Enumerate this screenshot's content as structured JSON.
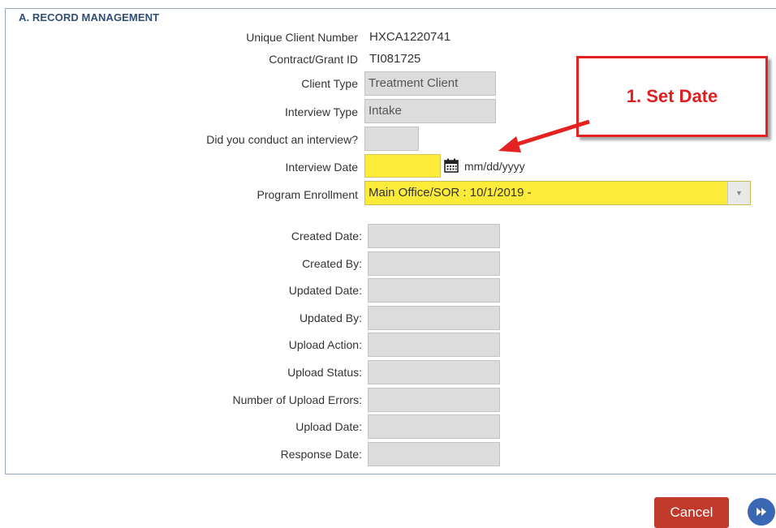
{
  "section": {
    "title": "A. RECORD MANAGEMENT"
  },
  "fields": {
    "unique_client_number": {
      "label": "Unique Client Number",
      "value": "HXCA1220741"
    },
    "contract_grant_id": {
      "label": "Contract/Grant ID",
      "value": "TI081725"
    },
    "client_type": {
      "label": "Client Type",
      "value": "Treatment Client"
    },
    "interview_type": {
      "label": "Interview Type",
      "value": "Intake"
    },
    "conducted_interview": {
      "label": "Did you conduct an interview?",
      "value": ""
    },
    "interview_date": {
      "label": "Interview Date",
      "value": "",
      "format_hint": "mm/dd/yyyy"
    },
    "program_enrollment": {
      "label": "Program Enrollment",
      "value": "Main Office/SOR : 10/1/2019 -"
    }
  },
  "metadata_fields": [
    {
      "label": "Created Date:",
      "value": ""
    },
    {
      "label": "Created By:",
      "value": ""
    },
    {
      "label": "Updated Date:",
      "value": ""
    },
    {
      "label": "Updated By:",
      "value": ""
    },
    {
      "label": "Upload Action:",
      "value": ""
    },
    {
      "label": "Upload Status:",
      "value": ""
    },
    {
      "label": "Number of Upload Errors:",
      "value": ""
    },
    {
      "label": "Upload Date:",
      "value": ""
    },
    {
      "label": "Response Date:",
      "value": ""
    }
  ],
  "callout": {
    "text": "1. Set Date"
  },
  "buttons": {
    "cancel": "Cancel",
    "next_icon": "fast-forward-icon"
  },
  "colors": {
    "highlight": "#fdeb3a",
    "callout_red": "#e52222",
    "cancel_bg": "#c0392b",
    "next_bg": "#3a68b4",
    "legend_text": "#2f4f75"
  },
  "icons": {
    "date_picker": "calendar-icon",
    "dropdown": "caret-down-icon"
  }
}
